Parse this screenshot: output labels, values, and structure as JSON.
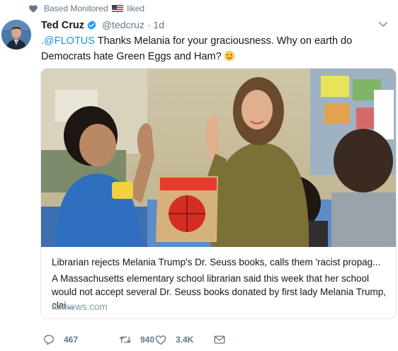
{
  "social_context": {
    "actor": "Based Monitored",
    "action": "liked",
    "icon": "heart-icon",
    "flag": "us-flag-icon"
  },
  "tweet": {
    "display_name": "Ted Cruz",
    "handle": "@tedcruz",
    "separator": "·",
    "time": "1d",
    "mention": ".@FLOTUS",
    "text": " Thanks Melania for your graciousness. Why on earth do Democrats hate Green Eggs and Ham?",
    "emoji": "winking-face-emoji"
  },
  "card": {
    "title": "Librarian rejects Melania Trump's Dr. Seuss books, calls them 'racist propag...",
    "description": "A Massachusetts elementary school librarian said this week that her school would not accept several Dr. Seuss books donated by first lady Melania Trump, clai...",
    "domain": "foxnews.com"
  },
  "actions": {
    "replies": "467",
    "retweets": "940",
    "likes": "3.4K"
  },
  "colors": {
    "link": "#1b95e0",
    "secondary": "#657786",
    "border": "#e1e8ed",
    "verified": "#1da1f2"
  }
}
